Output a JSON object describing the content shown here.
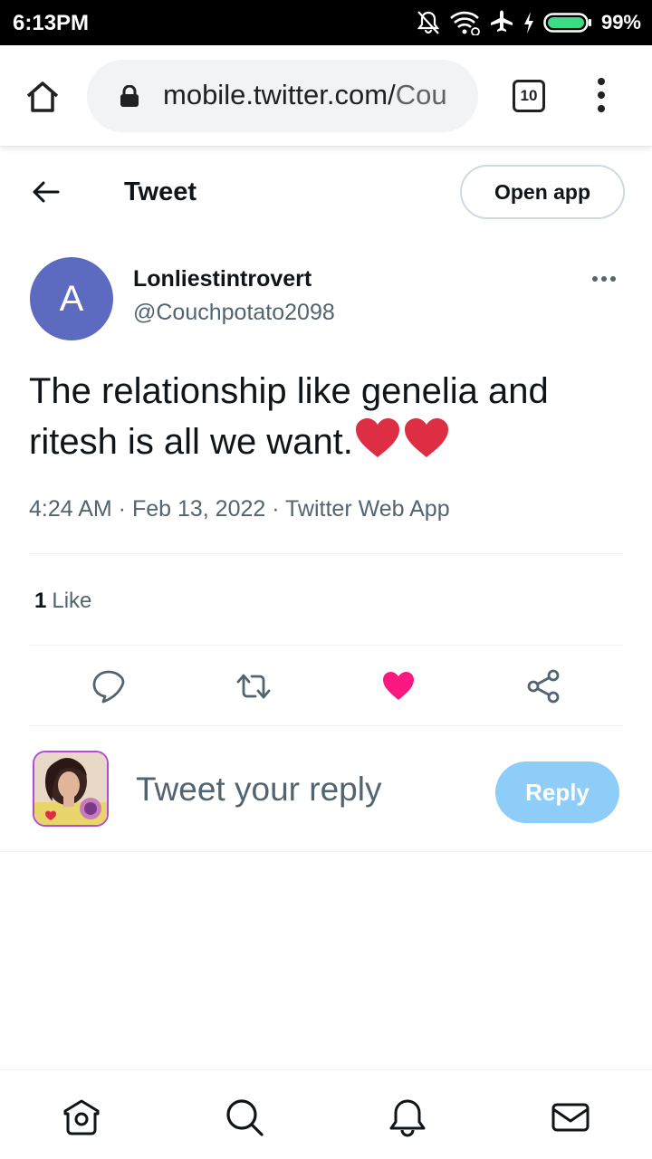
{
  "status_bar": {
    "time": "6:13PM",
    "battery_percent": "99%",
    "icons": [
      "notifications-off-icon",
      "wifi-icon",
      "airplane-icon",
      "charging-icon",
      "battery-icon"
    ]
  },
  "browser": {
    "url_main": "mobile.twitter.com/",
    "url_rest": "Cou",
    "tab_count": "10"
  },
  "header": {
    "title": "Tweet",
    "open_app_label": "Open app"
  },
  "tweet": {
    "avatar_letter": "A",
    "avatar_color": "#5c6bc0",
    "display_name": "Lonliestintrovert",
    "handle": "@Couchpotato2098",
    "text": "The relationship like genelia and ritesh is all we want.",
    "emoji": [
      "red-heart-emoji",
      "red-heart-emoji"
    ],
    "meta": "4:24 AM · Feb 13, 2022 · Twitter Web App",
    "like_count": "1",
    "like_label": "Like",
    "liked": true,
    "like_color": "#f91880"
  },
  "reply": {
    "placeholder": "Tweet your reply",
    "button_label": "Reply",
    "button_color": "#8ecdf8"
  },
  "bottom_nav": [
    "home-icon",
    "search-icon",
    "notifications-icon",
    "messages-icon"
  ]
}
